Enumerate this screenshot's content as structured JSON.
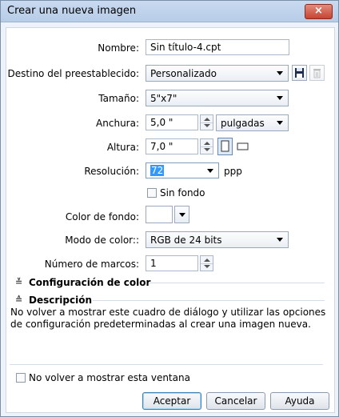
{
  "window": {
    "title": "Crear una nueva imagen",
    "close_label": "×"
  },
  "form": {
    "nombre": {
      "label": "Nombre:",
      "value": "Sin título-4.cpt"
    },
    "destino": {
      "label": "Destino del preestablecido:",
      "value": "Personalizado"
    },
    "tamano": {
      "label": "Tamaño:",
      "value": "5\"x7\""
    },
    "anchura": {
      "label": "Anchura:",
      "value": "5,0 \"",
      "units": "pulgadas"
    },
    "altura": {
      "label": "Altura:",
      "value": "7,0 \""
    },
    "resolucion": {
      "label": "Resolución:",
      "value": "72",
      "units": "ppp"
    },
    "sin_fondo": {
      "label": "Sin fondo",
      "checked": false
    },
    "color_fondo": {
      "label": "Color de fondo:"
    },
    "modo_color": {
      "label": "Modo de color::",
      "value": "RGB de 24 bits"
    },
    "marcos": {
      "label": "Número de marcos:",
      "value": "1"
    }
  },
  "sections": {
    "config_color": "Configuración de color",
    "descripcion": "Descripción",
    "descripcion_text": "No volver a mostrar este cuadro de diálogo y utilizar las opciones de configuración predeterminadas al crear una imagen nueva."
  },
  "footer": {
    "no_mostrar": "No volver a mostrar esta ventana",
    "aceptar": "Aceptar",
    "cancelar": "Cancelar",
    "ayuda": "Ayuda"
  },
  "icons": {
    "save": "save-icon",
    "delete": "trash-icon",
    "portrait": "portrait-icon",
    "landscape": "landscape-icon",
    "collapse": "chevron-double-down-icon",
    "expand": "chevron-double-up-icon"
  },
  "colors": {
    "title_bg": "#c9daf0",
    "close": "#c74333",
    "selection": "#3399ff"
  }
}
